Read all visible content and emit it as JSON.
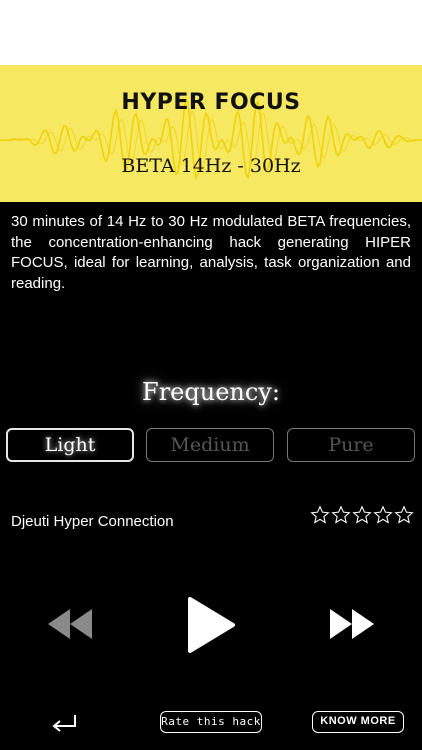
{
  "banner": {
    "title": "HYPER FOCUS",
    "subtitle": "BETA 14Hz - 30Hz",
    "background": "#f7e862",
    "wave_color": "#f0d20a"
  },
  "description": "30 minutes of 14 Hz to 30 Hz modulated BETA frequencies, the concentration-enhancing hack generating HIPER FOCUS, ideal for learning, analysis, task organization and reading.",
  "frequency": {
    "heading": "Frequency:",
    "options": [
      "Light",
      "Medium",
      "Pure"
    ],
    "selected": "Light"
  },
  "track": {
    "name": "Djeuti Hyper Connection",
    "rating": 0,
    "rating_max": 5
  },
  "controls": {
    "rewind_icon": "rewind-icon",
    "play_icon": "play-icon",
    "forward_icon": "fast-forward-icon"
  },
  "footer": {
    "back_icon": "return-arrow-icon",
    "rate_label": "Rate this hack",
    "know_more_label": "KNOW MORE"
  }
}
